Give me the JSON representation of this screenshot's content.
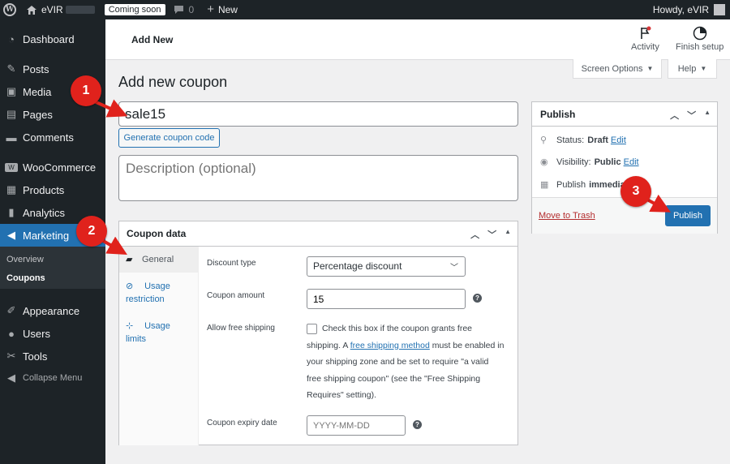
{
  "adminbar": {
    "site_name": "eVIR",
    "coming_soon": "Coming soon",
    "comments_count": "0",
    "new_label": "New",
    "howdy": "Howdy, eVIR"
  },
  "sidebar": {
    "items": [
      {
        "label": "Dashboard",
        "icon": "dashboard-icon"
      },
      {
        "label": "Posts",
        "icon": "pin-icon"
      },
      {
        "label": "Media",
        "icon": "media-icon"
      },
      {
        "label": "Pages",
        "icon": "pages-icon"
      },
      {
        "label": "Comments",
        "icon": "comment-icon"
      },
      {
        "label": "WooCommerce",
        "icon": "woocommerce-icon"
      },
      {
        "label": "Products",
        "icon": "products-icon"
      },
      {
        "label": "Analytics",
        "icon": "analytics-icon"
      },
      {
        "label": "Marketing",
        "icon": "megaphone-icon"
      },
      {
        "label": "Appearance",
        "icon": "brush-icon"
      },
      {
        "label": "Users",
        "icon": "users-icon"
      },
      {
        "label": "Tools",
        "icon": "wrench-icon"
      },
      {
        "label": "Collapse Menu",
        "icon": "collapse-icon"
      }
    ],
    "submenu": [
      "Overview",
      "Coupons"
    ]
  },
  "header": {
    "title": "Add New",
    "activity": "Activity",
    "finish_setup": "Finish setup"
  },
  "screen_options": "Screen Options",
  "help": "Help",
  "page_title": "Add new coupon",
  "coupon": {
    "code": "sale15",
    "generate_label": "Generate coupon code",
    "description_placeholder": "Description (optional)"
  },
  "coupon_data": {
    "title": "Coupon data",
    "tabs": [
      "General",
      "Usage restriction",
      "Usage limits"
    ],
    "discount_type_label": "Discount type",
    "discount_type_value": "Percentage discount",
    "amount_label": "Coupon amount",
    "amount_value": "15",
    "free_shipping_label": "Allow free shipping",
    "free_shipping_text_1": "Check this box if the coupon grants free shipping. A ",
    "free_shipping_link": "free shipping method",
    "free_shipping_text_2": " must be enabled in your shipping zone and be set to require \"a valid free shipping coupon\" (see the \"Free Shipping Requires\" setting).",
    "expiry_label": "Coupon expiry date",
    "expiry_placeholder": "YYYY-MM-DD"
  },
  "publish": {
    "title": "Publish",
    "status_label": "Status:",
    "status_value": "Draft",
    "visibility_label": "Visibility:",
    "visibility_value": "Public",
    "edit": "Edit",
    "publish_label": "Publish",
    "publish_value": "immedia",
    "trash": "Move to Trash",
    "button": "Publish"
  },
  "callouts": [
    "1",
    "2",
    "3"
  ],
  "colors": {
    "accent": "#2271b1",
    "admin_dark": "#1d2327",
    "callout": "#e0221c"
  }
}
